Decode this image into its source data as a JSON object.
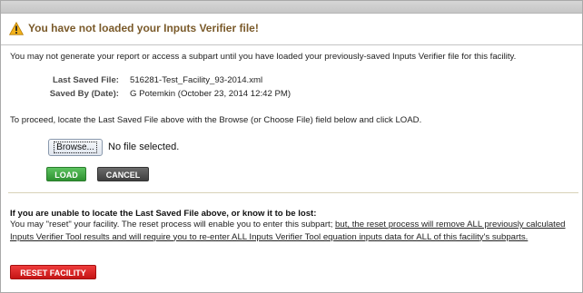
{
  "header": {
    "title": "You have not loaded your Inputs Verifier file!",
    "icon": "warning-icon"
  },
  "intro": "You may not generate your report or access a subpart until you have loaded your previously-saved Inputs Verifier file for this facility.",
  "saved_info": {
    "last_saved_label": "Last Saved File:",
    "last_saved_value": "516281-Test_Facility_93-2014.xml",
    "saved_by_label": "Saved By (Date):",
    "saved_by_value": "G Potemkin (October 23, 2014 12:42 PM)"
  },
  "instructions": "To proceed, locate the Last Saved File above with the Browse (or Choose File) field below and click LOAD.",
  "file_input": {
    "browse_label": "Browse...",
    "status": "No file selected."
  },
  "buttons": {
    "load": "LOAD",
    "cancel": "CANCEL",
    "reset": "RESET FACILITY"
  },
  "reset_section": {
    "heading": "If you are unable to locate the Last Saved File above, or know it to be lost:",
    "text_plain": "You may \"reset\" your facility. The reset process will enable you to enter this subpart; ",
    "text_underlined": "but, the reset process will remove ALL previously calculated Inputs Verifier Tool results and will require you to re-enter ALL Inputs Verifier Tool equation inputs data for ALL of this facility's subparts."
  },
  "colors": {
    "title": "#7a5a2a",
    "load": "#2e9131",
    "cancel": "#3f3f3f",
    "reset": "#c51515"
  }
}
